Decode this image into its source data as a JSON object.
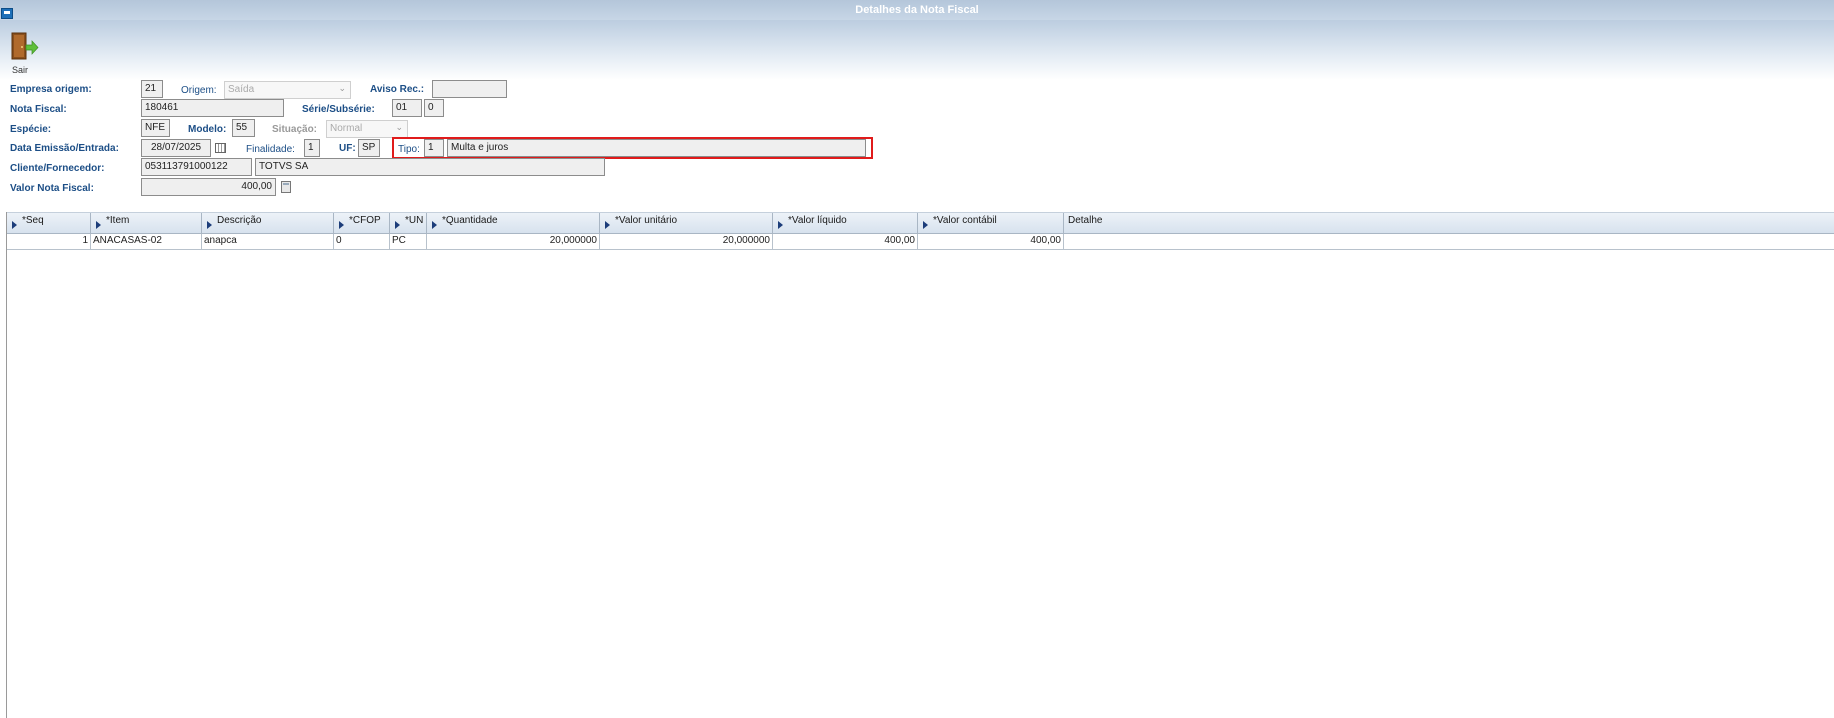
{
  "window": {
    "title": "Detalhes da Nota Fiscal"
  },
  "toolbar": {
    "exit_label": "Sair"
  },
  "form": {
    "empresa_origem": {
      "label": "Empresa origem:",
      "value": "21"
    },
    "origem": {
      "label": "Origem:",
      "value": "Saída"
    },
    "aviso_rec": {
      "label": "Aviso Rec.:",
      "value": ""
    },
    "nota_fiscal": {
      "label": "Nota Fiscal:",
      "value": "180461"
    },
    "serie_subserie": {
      "label": "Série/Subsérie:",
      "serie": "01",
      "subserie": "0"
    },
    "especie": {
      "label": "Espécie:",
      "value": "NFE"
    },
    "modelo": {
      "label": "Modelo:",
      "value": "55"
    },
    "situacao": {
      "label": "Situação:",
      "value": "Normal"
    },
    "data_emissao": {
      "label": "Data Emissão/Entrada:",
      "value": "28/07/2025"
    },
    "finalidade": {
      "label": "Finalidade:",
      "value": "1"
    },
    "uf": {
      "label": "UF:",
      "value": "SP"
    },
    "tipo": {
      "label": "Tipo:",
      "code": "1",
      "description": "Multa e juros"
    },
    "cliente_fornecedor": {
      "label": "Cliente/Fornecedor:",
      "code": "053113791000122",
      "name": "TOTVS SA"
    },
    "valor_nota_fiscal": {
      "label": "Valor Nota Fiscal:",
      "value": "400,00"
    }
  },
  "grid": {
    "columns": [
      "*Seq",
      "*Item",
      "Descrição",
      "*CFOP",
      "*UN",
      "*Quantidade",
      "*Valor unitário",
      "*Valor líquido",
      "*Valor contábil",
      "Detalhe"
    ],
    "rows": [
      {
        "seq": "1",
        "item": "ANACASAS-02",
        "descricao": "anapca",
        "cfop": "0",
        "un": "PC",
        "quantidade": "20,000000",
        "valor_unitario": "20,000000",
        "valor_liquido": "400,00",
        "valor_contabil": "400,00",
        "detalhe_icon": "magnifier-icon"
      }
    ]
  },
  "colors": {
    "label_blue": "#1c4e86",
    "highlight_red": "#e01b1b",
    "titlebar": "#b4c6da"
  }
}
